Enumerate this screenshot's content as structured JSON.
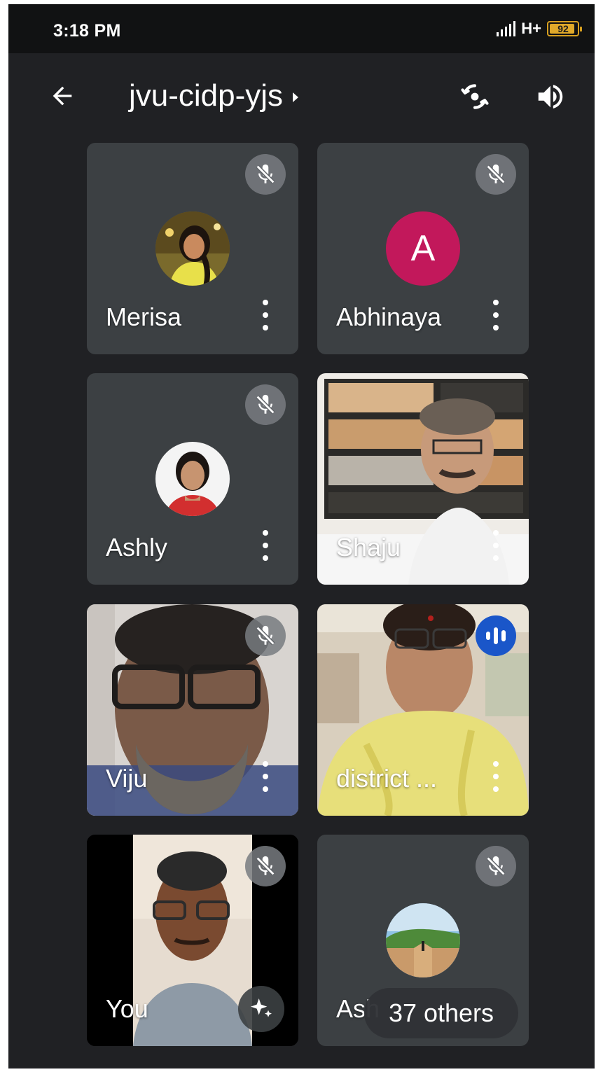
{
  "status_bar": {
    "time": "3:18 PM",
    "network": "H+",
    "battery_percent": 92,
    "battery_text": "92",
    "battery_color": "#e0a92a"
  },
  "header": {
    "back_icon": "arrow-back-icon",
    "meeting_code": "jvu-cidp-yjs",
    "switch_camera_icon": "switch-camera-icon",
    "audio_icon": "speaker-icon"
  },
  "participants": [
    {
      "name": "Merisa",
      "muted": true,
      "avatar": "photo",
      "has_video": false
    },
    {
      "name": "Abhinaya",
      "muted": true,
      "avatar": "A",
      "avatar_color": "#c2185b",
      "has_video": false
    },
    {
      "name": "Ashly",
      "muted": true,
      "avatar": "photo",
      "has_video": false
    },
    {
      "name": "Shaju",
      "muted": false,
      "has_video": true
    },
    {
      "name": "Viju",
      "muted": true,
      "has_video": true
    },
    {
      "name": "district ...",
      "muted": false,
      "speaking": true,
      "has_video": true
    },
    {
      "name": "You",
      "muted": true,
      "has_video": true,
      "effects_icon": "sparkle-effects-icon"
    },
    {
      "name": "Ash",
      "muted": true,
      "avatar": "photo",
      "has_video": false
    }
  ],
  "others": {
    "label": "37 others"
  },
  "colors": {
    "background": "#202124",
    "tile": "#3c4043",
    "speaking_indicator": "#1a56c9"
  }
}
